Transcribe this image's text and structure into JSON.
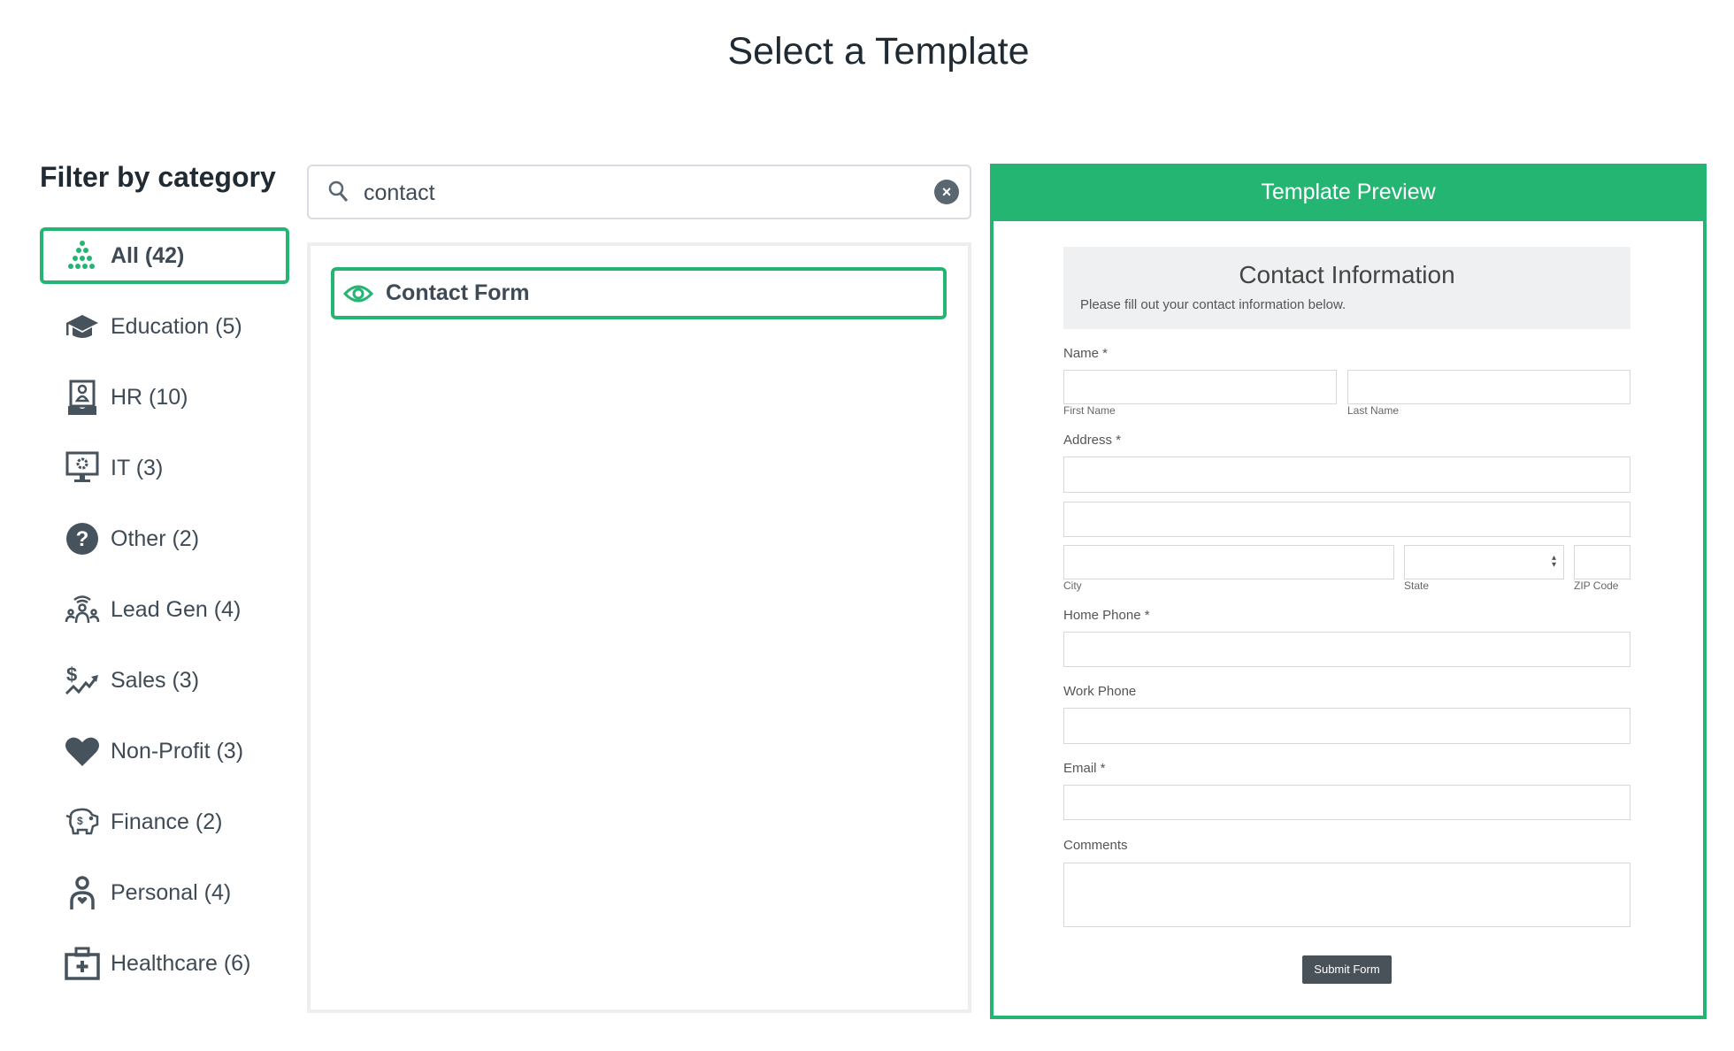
{
  "page": {
    "title": "Select a Template"
  },
  "filter": {
    "title": "Filter by category",
    "accent": "#24b573",
    "items": [
      {
        "label": "All (42)",
        "icon": "all-icon",
        "active": true
      },
      {
        "label": "Education (5)",
        "icon": "graduation-cap-icon"
      },
      {
        "label": "HR (10)",
        "icon": "hr-badge-icon"
      },
      {
        "label": "IT (3)",
        "icon": "monitor-gear-icon"
      },
      {
        "label": "Other (2)",
        "icon": "question-circle-icon"
      },
      {
        "label": "Lead Gen (4)",
        "icon": "people-signal-icon"
      },
      {
        "label": "Sales (3)",
        "icon": "dollar-trend-icon"
      },
      {
        "label": "Non-Profit (3)",
        "icon": "heart-icon"
      },
      {
        "label": "Finance (2)",
        "icon": "piggy-bank-icon"
      },
      {
        "label": "Personal (4)",
        "icon": "person-heart-icon"
      },
      {
        "label": "Healthcare (6)",
        "icon": "medical-kit-icon"
      }
    ]
  },
  "search": {
    "value": "contact"
  },
  "results": [
    {
      "label": "Contact Form"
    }
  ],
  "preview": {
    "header": "Template Preview",
    "form": {
      "title": "Contact Information",
      "subtitle": "Please fill out your contact information below.",
      "name": "Name *",
      "first": "First Name",
      "last": "Last Name",
      "address": "Address *",
      "city": "City",
      "state": "State",
      "zip": "ZIP Code",
      "home": "Home Phone *",
      "work": "Work Phone",
      "email": "Email *",
      "comments": "Comments",
      "submit": "Submit Form"
    }
  }
}
